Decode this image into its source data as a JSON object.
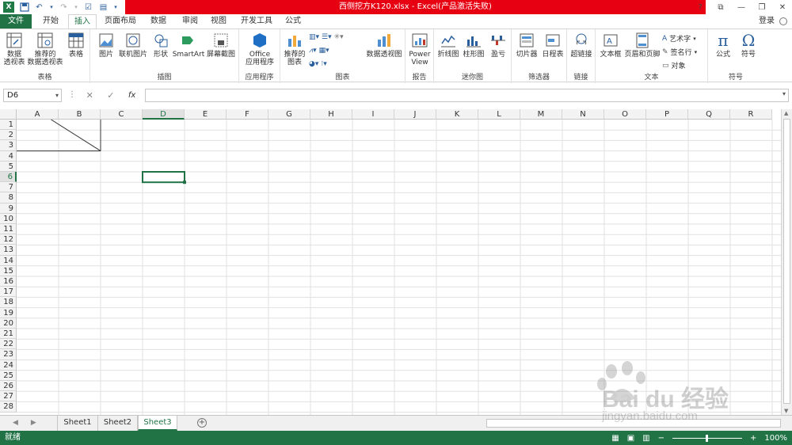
{
  "title": {
    "document": "西侧挖方K120.xlsx",
    "separator": "-",
    "app": "Excel(产品激活失败)"
  },
  "window": {
    "help": "?",
    "ribbon_display": "⧉",
    "minimize": "—",
    "restore": "❐",
    "close": "✕"
  },
  "tabs": [
    {
      "label": "文件"
    },
    {
      "label": "开始"
    },
    {
      "label": "插入"
    },
    {
      "label": "页面布局"
    },
    {
      "label": "数据"
    },
    {
      "label": "审阅"
    },
    {
      "label": "视图"
    },
    {
      "label": "开发工具"
    },
    {
      "label": "公式"
    }
  ],
  "account": {
    "login": "登录"
  },
  "ribbon": {
    "groups": {
      "tables": "表格",
      "illustrations": "插图",
      "apps": "应用程序",
      "charts": "图表",
      "reports": "报告",
      "sparklines": "迷你图",
      "filters": "筛选器",
      "links": "链接",
      "text": "文本",
      "symbols": "符号"
    },
    "buttons": {
      "pivot_table_1": "数据",
      "pivot_table_2": "透视表",
      "recommended_pivot_1": "推荐的",
      "recommended_pivot_2": "数据透视表",
      "table": "表格",
      "picture": "图片",
      "online_picture": "联机图片",
      "shapes": "形状",
      "smartart": "SmartArt",
      "screenshot": "屏幕截图",
      "office_apps_1": "Office",
      "office_apps_2": "应用程序",
      "recommended_charts_1": "推荐的",
      "recommended_charts_2": "图表",
      "pivot_chart": "数据透视图",
      "power_view_1": "Power",
      "power_view_2": "View",
      "line": "折线图",
      "column": "柱形图",
      "win_loss": "盈亏",
      "slicer": "切片器",
      "timeline": "日程表",
      "hyperlink": "超链接",
      "textbox": "文本框",
      "header_footer": "页眉和页脚",
      "wordart": "艺术字",
      "signature": "签名行",
      "object": "对象",
      "equation": "公式",
      "symbol": "符号"
    }
  },
  "formula_bar": {
    "name_box": "D6",
    "formula": "",
    "cancel": "✕",
    "enter": "✓",
    "fx": "fx"
  },
  "columns": [
    "A",
    "B",
    "C",
    "D",
    "E",
    "F",
    "G",
    "H",
    "I",
    "J",
    "K",
    "L",
    "M",
    "N",
    "O",
    "P",
    "Q",
    "R"
  ],
  "rows": [
    "1",
    "2",
    "3",
    "4",
    "5",
    "6",
    "7",
    "8",
    "9",
    "10",
    "11",
    "12",
    "13",
    "14",
    "15",
    "16",
    "17",
    "18",
    "19",
    "20",
    "21",
    "22",
    "23",
    "24",
    "25",
    "26",
    "27",
    "28"
  ],
  "selected_cell": {
    "column": "D",
    "row": "6"
  },
  "sheets": [
    {
      "label": "Sheet1"
    },
    {
      "label": "Sheet2"
    },
    {
      "label": "Sheet3",
      "active": true
    }
  ],
  "status": {
    "mode": "就绪",
    "zoom": "100%",
    "zoom_out": "−",
    "zoom_in": "+"
  },
  "watermark": {
    "brand": "Bai du 经验",
    "url": "jingyan.baidu.com"
  },
  "colors": {
    "accent": "#217346",
    "title_red": "#e60012",
    "gridline": "#e1e1e1",
    "header_bg": "#f3f3f3"
  }
}
